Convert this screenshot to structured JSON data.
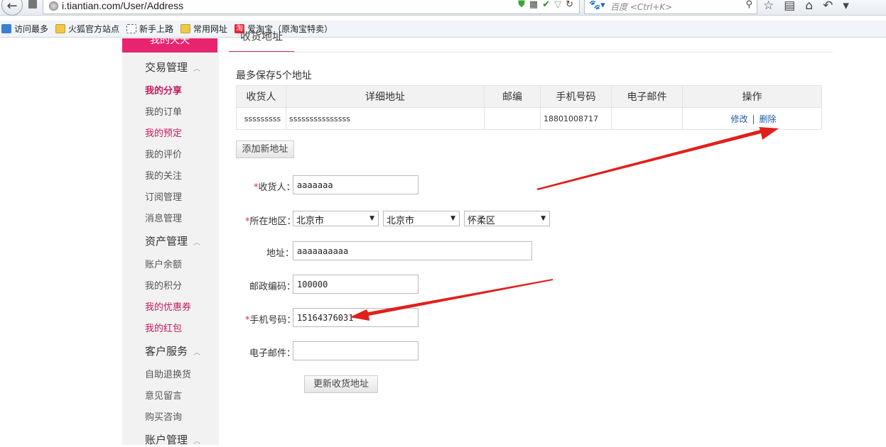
{
  "browser": {
    "url": "i.tiantian.com/User/Address",
    "search_placeholder": "百度 <Ctrl+K>",
    "bookmarks": [
      "访问最多",
      "火狐官方站点",
      "新手上路",
      "常用网址",
      "爱淘宝（原淘宝特卖）"
    ]
  },
  "sidebar": {
    "top_label": "我的天天",
    "groups": [
      {
        "title": "交易管理",
        "items": [
          "我的分享",
          "我的订单",
          "我的预定",
          "我的评价",
          "我的关注",
          "订阅管理",
          "消息管理"
        ]
      },
      {
        "title": "资产管理",
        "items": [
          "账户余额",
          "我的积分",
          "我的优惠券",
          "我的红包"
        ]
      },
      {
        "title": "客户服务",
        "items": [
          "自助退换货",
          "意见留言",
          "购买咨询"
        ]
      },
      {
        "title": "账户管理"
      }
    ]
  },
  "main": {
    "tab_title": "收货地址",
    "max_note": "最多保存5个地址",
    "table": {
      "headers": [
        "收货人",
        "详细地址",
        "邮编",
        "手机号码",
        "电子邮件",
        "操作"
      ],
      "rows": [
        {
          "name": "sssssssss",
          "address": "sssssssssssssss",
          "zip": "",
          "phone": "18801008717",
          "email": "",
          "edit": "修改",
          "sep": "|",
          "delete": "删除"
        }
      ]
    },
    "add_button": "添加新地址",
    "form": {
      "required_mark": "*",
      "recipient_label": "收货人：",
      "recipient_value": "aaaaaaa",
      "region_label": "所在地区：",
      "province": "北京市",
      "city": "北京市",
      "district": "怀柔区",
      "address_label": "地址：",
      "address_value": "aaaaaaaaaa",
      "zip_label": "邮政编码：",
      "zip_value": "100000",
      "phone_label": "手机号码：",
      "phone_value": "15164376031",
      "email_label": "电子邮件：",
      "email_value": ""
    },
    "update_button": "更新收货地址"
  },
  "colors": {
    "accent": "#e8246f",
    "link": "#1d5aa6",
    "annotation_arrow": "#e0201b"
  }
}
